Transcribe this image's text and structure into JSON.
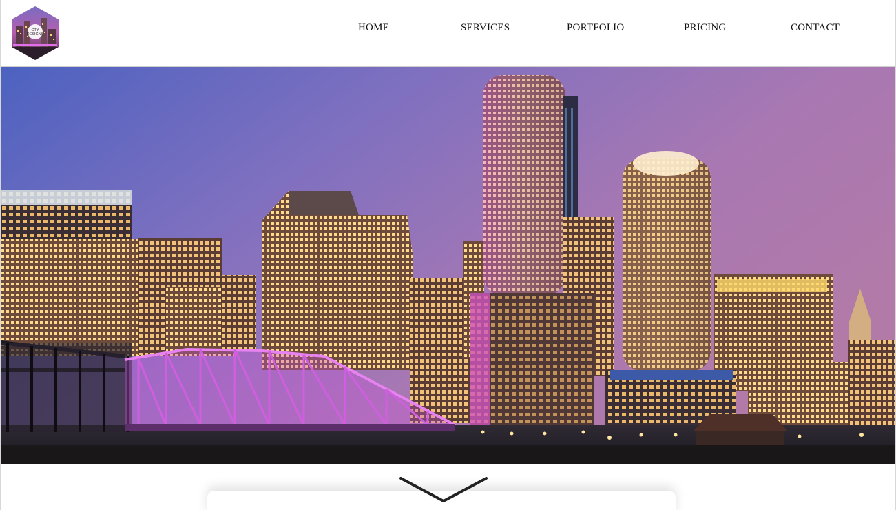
{
  "logo": {
    "text_line1": "CTY",
    "text_line2": "DESIGNS",
    "icon": "city-designs-hexagon-logo"
  },
  "nav": {
    "items": [
      {
        "label": "HOME"
      },
      {
        "label": "SERVICES"
      },
      {
        "label": "PORTFOLIO"
      },
      {
        "label": "PRICING"
      },
      {
        "label": "CONTACT"
      }
    ]
  },
  "hero": {
    "image": "boston-night-skyline-photo"
  },
  "scroll": {
    "icon": "chevron-down-icon"
  },
  "colors": {
    "sky_top": "#6d6bc3",
    "sky_bottom": "#9c73a8",
    "bridge_glow": "#d55be0",
    "window_light": "#ffd27a",
    "nav_text": "#111111"
  }
}
